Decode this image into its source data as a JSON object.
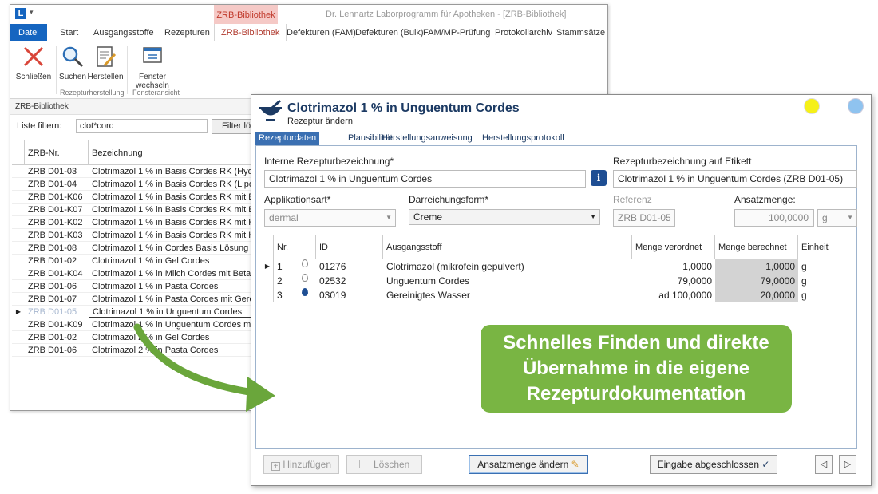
{
  "app": {
    "title": "Dr. Lennartz Laborprogramm für Apotheken - [ZRB-Bibliothek]",
    "context_tab_header": "ZRB-Bibliothek",
    "tabs": [
      "Datei",
      "Start",
      "Ausgangsstoffe",
      "Rezepturen",
      "ZRB-Bibliothek",
      "Defekturen (FAM)",
      "Defekturen (Bulk)",
      "FAM/MP-Prüfung",
      "Protokollarchiv",
      "Stammsätze"
    ],
    "ribbon": {
      "close_label": "Schließen",
      "search_label": "Suchen",
      "produce_label": "Herstellen",
      "switch_window_line1": "Fenster",
      "switch_window_line2": "wechseln",
      "group_rezeptur": "Rezepturherstellung",
      "group_fenster": "Fensteransicht"
    },
    "section_title": "ZRB-Bibliothek",
    "filter": {
      "label": "Liste filtern:",
      "value": "clot*cord",
      "button": "Filter lös"
    },
    "columns": [
      "ZRB-Nr.",
      "Bezeichnung"
    ],
    "rows": [
      {
        "nr": "ZRB D01-03",
        "bez": "Clotrimazol 1 % in Basis Cordes RK (Hydrop"
      },
      {
        "nr": "ZRB D01-04",
        "bez": "Clotrimazol 1 % in Basis Cordes RK (Lipoph"
      },
      {
        "nr": "ZRB D01-K06",
        "bez": "Clotrimazol 1 % in Basis Cordes RK mit Beta"
      },
      {
        "nr": "ZRB D01-K07",
        "bez": "Clotrimazol 1 % in Basis Cordes RK mit Beta"
      },
      {
        "nr": "ZRB D01-K02",
        "bez": "Clotrimazol 1 % in Basis Cordes RK mit Har"
      },
      {
        "nr": "ZRB D01-K03",
        "bez": "Clotrimazol 1 % in Basis Cordes RK mit Har"
      },
      {
        "nr": "ZRB D01-08",
        "bez": "Clotrimazol 1 % in Cordes Basis Lösung"
      },
      {
        "nr": "ZRB D01-02",
        "bez": "Clotrimazol 1 % in Gel Cordes"
      },
      {
        "nr": "ZRB D01-K04",
        "bez": "Clotrimazol 1 % in Milch Cordes mit Betam"
      },
      {
        "nr": "ZRB D01-06",
        "bez": "Clotrimazol 1 % in Pasta Cordes"
      },
      {
        "nr": "ZRB D01-07",
        "bez": "Clotrimazol 1 % in Pasta Cordes mit Gerein"
      },
      {
        "nr": "ZRB D01-05",
        "bez": "Clotrimazol 1 % in Unguentum Cordes"
      },
      {
        "nr": "ZRB D01-K09",
        "bez": "Clotrimazol 1 % in Unguentum Cordes mit I"
      },
      {
        "nr": "ZRB D01-02",
        "bez": "Clotrimazol 2 % in Gel Cordes"
      },
      {
        "nr": "ZRB D01-06",
        "bez": "Clotrimazol 2 % in Pasta Cordes"
      }
    ]
  },
  "dialog": {
    "title": "Clotrimazol 1 % in Unguentum Cordes",
    "subtitle": "Rezeptur ändern",
    "tabs": [
      "Rezepturdaten",
      "Plausibilität",
      "Herstellungsanweisung",
      "Herstellungsprotokoll"
    ],
    "labels": {
      "interne": "Interne Rezepturbezeichnung*",
      "etikett": "Rezepturbezeichnung auf Etikett",
      "applikation": "Applikationsart*",
      "darreichung": "Darreichungsform*",
      "referenz": "Referenz",
      "ansatz": "Ansatzmenge:"
    },
    "values": {
      "interne": "Clotrimazol 1 % in Unguentum Cordes",
      "etikett": "Clotrimazol 1 % in Unguentum Cordes (ZRB D01-05)",
      "applikation": "dermal",
      "darreichung": "Creme",
      "referenz": "ZRB D01-05",
      "ansatz": "100,0000",
      "einheit": "g"
    },
    "grid_columns": [
      "Nr.",
      "ID",
      "Ausgangsstoff",
      "Menge verordnet",
      "Menge berechnet",
      "Einheit"
    ],
    "grid_rows": [
      {
        "nr": "1",
        "id": "01276",
        "stoff": "Clotrimazol (mikrofein gepulvert)",
        "verordnet": "1,0000",
        "berechnet": "1,0000",
        "einheit": "g"
      },
      {
        "nr": "2",
        "id": "02532",
        "stoff": "Unguentum Cordes",
        "verordnet": "79,0000",
        "berechnet": "79,0000",
        "einheit": "g"
      },
      {
        "nr": "3",
        "id": "03019",
        "stoff": "Gereinigtes Wasser",
        "verordnet": "ad 100,0000",
        "berechnet": "20,0000",
        "einheit": "g"
      }
    ],
    "buttons": {
      "add": "Hinzufügen",
      "delete": "Löschen",
      "change_amount": "Ansatzmenge ändern",
      "done": "Eingabe abgeschlossen"
    }
  },
  "callout": {
    "line1": "Schnelles Finden und direkte",
    "line2": "Übernahme in die eigene",
    "line3": "Rezepturdokumentation"
  },
  "colors": {
    "accent": "#3b70b2",
    "callout": "#79b543",
    "file_tab": "#1565c0",
    "context_tab": "#f5c9c6"
  }
}
